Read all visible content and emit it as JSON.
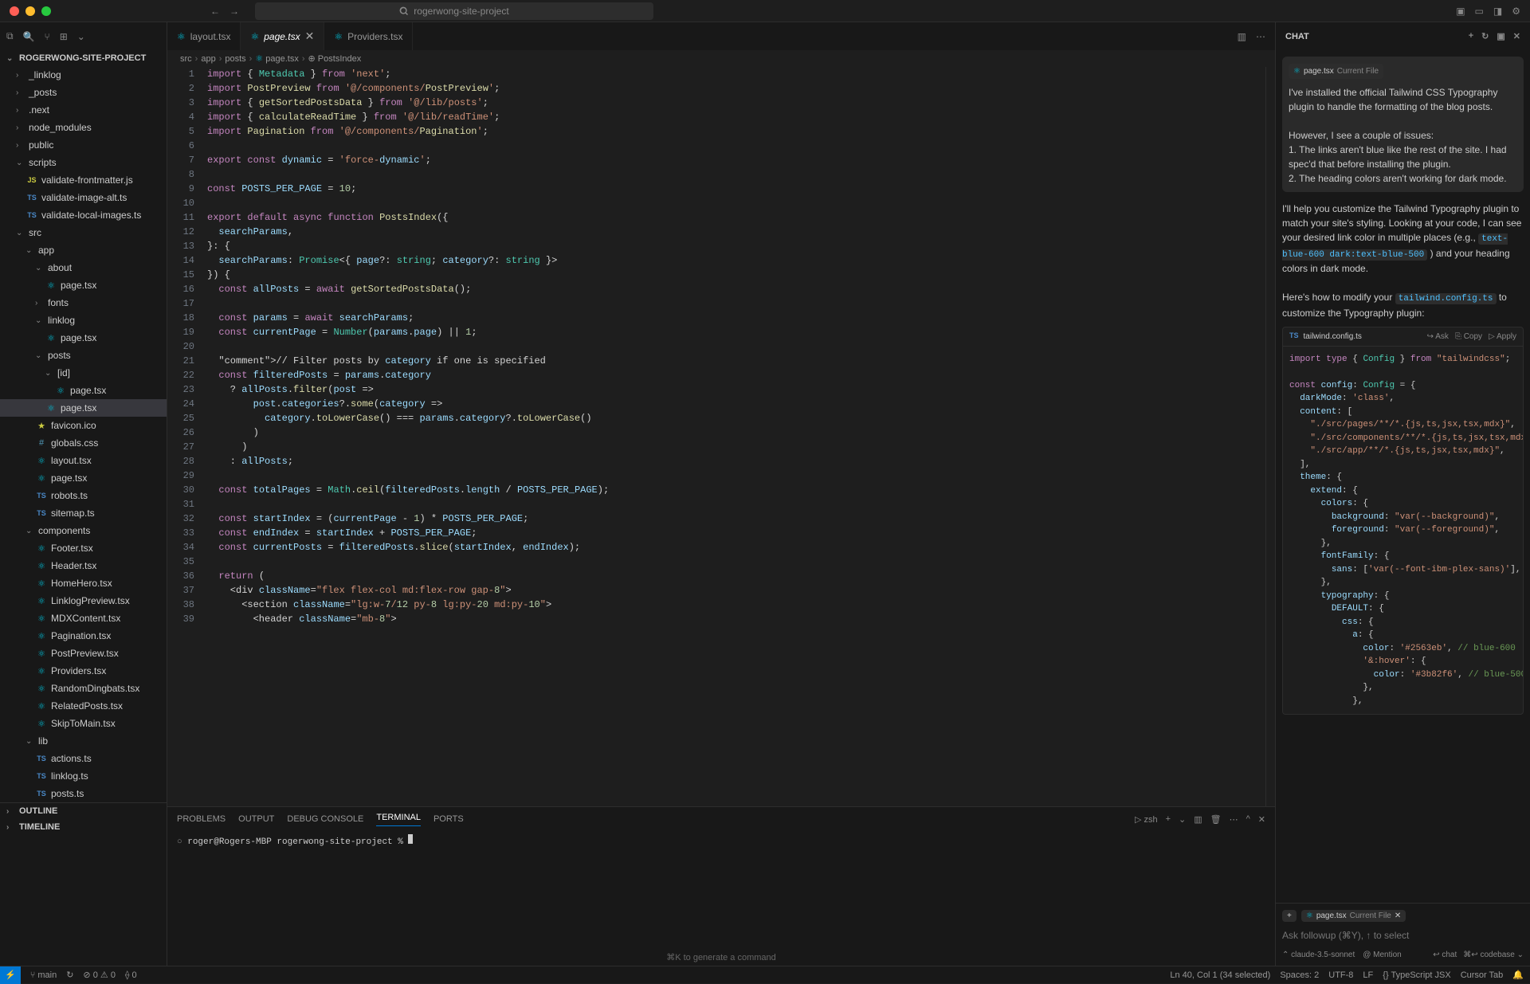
{
  "titlebar": {
    "search": "rogerwong-site-project"
  },
  "sidebar": {
    "project_name": "ROGERWONG-SITE-PROJECT",
    "outline_label": "OUTLINE",
    "timeline_label": "TIMELINE",
    "tree": [
      {
        "name": "_linklog",
        "type": "folder",
        "indent": 1
      },
      {
        "name": "_posts",
        "type": "folder",
        "indent": 1
      },
      {
        "name": ".next",
        "type": "folder",
        "indent": 1
      },
      {
        "name": "node_modules",
        "type": "folder",
        "indent": 1
      },
      {
        "name": "public",
        "type": "folder",
        "indent": 1
      },
      {
        "name": "scripts",
        "type": "folder",
        "indent": 1,
        "expanded": true
      },
      {
        "name": "validate-frontmatter.js",
        "type": "file",
        "icon": "js",
        "indent": 2
      },
      {
        "name": "validate-image-alt.ts",
        "type": "file",
        "icon": "ts",
        "indent": 2
      },
      {
        "name": "validate-local-images.ts",
        "type": "file",
        "icon": "ts",
        "indent": 2
      },
      {
        "name": "src",
        "type": "folder",
        "indent": 1,
        "expanded": true
      },
      {
        "name": "app",
        "type": "folder",
        "indent": 2,
        "expanded": true
      },
      {
        "name": "about",
        "type": "folder",
        "indent": 3,
        "expanded": true
      },
      {
        "name": "page.tsx",
        "type": "file",
        "icon": "react",
        "indent": 4
      },
      {
        "name": "fonts",
        "type": "folder",
        "indent": 3
      },
      {
        "name": "linklog",
        "type": "folder",
        "indent": 3,
        "expanded": true
      },
      {
        "name": "page.tsx",
        "type": "file",
        "icon": "react",
        "indent": 4
      },
      {
        "name": "posts",
        "type": "folder",
        "indent": 3,
        "expanded": true
      },
      {
        "name": "[id]",
        "type": "folder",
        "indent": 4,
        "expanded": true
      },
      {
        "name": "page.tsx",
        "type": "file",
        "icon": "react",
        "indent": 5
      },
      {
        "name": "page.tsx",
        "type": "file",
        "icon": "react",
        "indent": 4,
        "active": true
      },
      {
        "name": "favicon.ico",
        "type": "file",
        "icon": "ico",
        "indent": 3
      },
      {
        "name": "globals.css",
        "type": "file",
        "icon": "css",
        "indent": 3
      },
      {
        "name": "layout.tsx",
        "type": "file",
        "icon": "react",
        "indent": 3
      },
      {
        "name": "page.tsx",
        "type": "file",
        "icon": "react",
        "indent": 3
      },
      {
        "name": "robots.ts",
        "type": "file",
        "icon": "ts",
        "indent": 3
      },
      {
        "name": "sitemap.ts",
        "type": "file",
        "icon": "ts",
        "indent": 3
      },
      {
        "name": "components",
        "type": "folder",
        "indent": 2,
        "expanded": true
      },
      {
        "name": "Footer.tsx",
        "type": "file",
        "icon": "react",
        "indent": 3
      },
      {
        "name": "Header.tsx",
        "type": "file",
        "icon": "react",
        "indent": 3
      },
      {
        "name": "HomeHero.tsx",
        "type": "file",
        "icon": "react",
        "indent": 3
      },
      {
        "name": "LinklogPreview.tsx",
        "type": "file",
        "icon": "react",
        "indent": 3
      },
      {
        "name": "MDXContent.tsx",
        "type": "file",
        "icon": "react",
        "indent": 3
      },
      {
        "name": "Pagination.tsx",
        "type": "file",
        "icon": "react",
        "indent": 3
      },
      {
        "name": "PostPreview.tsx",
        "type": "file",
        "icon": "react",
        "indent": 3
      },
      {
        "name": "Providers.tsx",
        "type": "file",
        "icon": "react",
        "indent": 3
      },
      {
        "name": "RandomDingbats.tsx",
        "type": "file",
        "icon": "react",
        "indent": 3
      },
      {
        "name": "RelatedPosts.tsx",
        "type": "file",
        "icon": "react",
        "indent": 3
      },
      {
        "name": "SkipToMain.tsx",
        "type": "file",
        "icon": "react",
        "indent": 3
      },
      {
        "name": "lib",
        "type": "folder",
        "indent": 2,
        "expanded": true
      },
      {
        "name": "actions.ts",
        "type": "file",
        "icon": "ts",
        "indent": 3
      },
      {
        "name": "linklog.ts",
        "type": "file",
        "icon": "ts",
        "indent": 3
      },
      {
        "name": "posts.ts",
        "type": "file",
        "icon": "ts",
        "indent": 3
      }
    ]
  },
  "tabs": [
    {
      "name": "layout.tsx",
      "icon": "react"
    },
    {
      "name": "page.tsx",
      "icon": "react",
      "active": true,
      "dirty": true
    },
    {
      "name": "Providers.tsx",
      "icon": "react"
    }
  ],
  "breadcrumb": [
    "src",
    "app",
    "posts",
    "page.tsx",
    "PostsIndex"
  ],
  "code": {
    "lines": [
      "import { Metadata } from 'next';",
      "import PostPreview from '@/components/PostPreview';",
      "import { getSortedPostsData } from '@/lib/posts';",
      "import { calculateReadTime } from '@/lib/readTime';",
      "import Pagination from '@/components/Pagination';",
      "",
      "export const dynamic = 'force-dynamic';",
      "",
      "const POSTS_PER_PAGE = 10;",
      "",
      "export default async function PostsIndex({",
      "  searchParams,",
      "}: {",
      "  searchParams: Promise<{ page?: string; category?: string }>",
      "}) {",
      "  const allPosts = await getSortedPostsData();",
      "",
      "  const params = await searchParams;",
      "  const currentPage = Number(params.page) || 1;",
      "",
      "  // Filter posts by category if one is specified",
      "  const filteredPosts = params.category",
      "    ? allPosts.filter(post =>",
      "        post.categories?.some(category =>",
      "          category.toLowerCase() === params.category?.toLowerCase()",
      "        )",
      "      )",
      "    : allPosts;",
      "",
      "  const totalPages = Math.ceil(filteredPosts.length / POSTS_PER_PAGE);",
      "",
      "  const startIndex = (currentPage - 1) * POSTS_PER_PAGE;",
      "  const endIndex = startIndex + POSTS_PER_PAGE;",
      "  const currentPosts = filteredPosts.slice(startIndex, endIndex);",
      "",
      "  return (",
      "    <div className=\"flex flex-col md:flex-row gap-8\">",
      "      <section className=\"lg:w-7/12 py-8 lg:py-20 md:py-10\">",
      "        <header className=\"mb-8\">"
    ]
  },
  "terminal": {
    "tabs": [
      "PROBLEMS",
      "OUTPUT",
      "DEBUG CONSOLE",
      "TERMINAL",
      "PORTS"
    ],
    "active_tab": "TERMINAL",
    "shell": "zsh",
    "prompt": "roger@Rogers-MBP rogerwong-site-project % ",
    "hint": "⌘K to generate a command"
  },
  "chat": {
    "title": "CHAT",
    "context_file": "page.tsx",
    "context_label": "Current File",
    "user_msg": {
      "p1": "I've installed the official Tailwind CSS Typography plugin to handle the formatting of the blog posts.",
      "p2": "However, I see a couple of issues:",
      "p3": "1. The links aren't blue like the rest of the site. I had spec'd that before installing the plugin.",
      "p4": "2. The heading colors aren't working for dark mode."
    },
    "assistant_msg": {
      "p1a": "I'll help you customize the Tailwind Typography plugin to match your site's styling. Looking at your code, I can see your desired link color in multiple places (e.g., ",
      "code1": "text-blue-600 dark:text-blue-500",
      "p1b": " ) and your heading colors in dark mode.",
      "p2a": "Here's how to modify your ",
      "code2": "tailwind.config.ts",
      "p2b": " to customize the Typography plugin:"
    },
    "code_block": {
      "filename": "tailwind.config.ts",
      "actions": {
        "ask": "Ask",
        "copy": "Copy",
        "apply": "Apply"
      }
    },
    "input": {
      "placeholder": "Ask followup (⌘Y), ↑ to select",
      "context_file": "page.tsx",
      "context_label": "Current File",
      "model": "claude-3.5-sonnet",
      "mention": "@ Mention",
      "chat_btn": "chat",
      "codebase_btn": "codebase"
    }
  },
  "statusbar": {
    "branch": "main",
    "errors": "0",
    "warnings": "0",
    "ports": "0",
    "position": "Ln 40, Col 1 (34 selected)",
    "spaces": "Spaces: 2",
    "encoding": "UTF-8",
    "eol": "LF",
    "lang": "TypeScript JSX",
    "cursor": "Cursor Tab"
  }
}
